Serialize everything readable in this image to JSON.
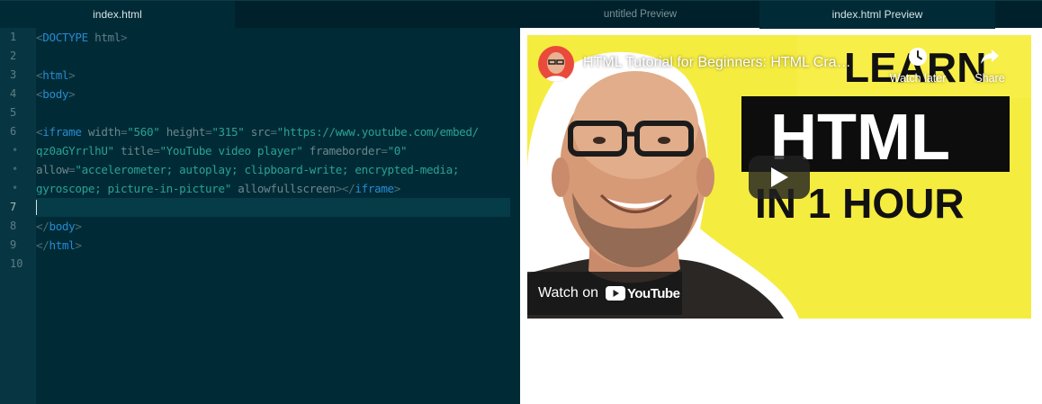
{
  "editor": {
    "tab_label": "index.html",
    "line_numbers": [
      "1",
      "2",
      "3",
      "4",
      "5",
      "6",
      "•",
      "•",
      "•",
      "7",
      "8",
      "9",
      "10"
    ],
    "active_line": "7",
    "code": {
      "doctype": "<DOCTYPE html>",
      "html_open": "<html>",
      "body_open": "<body>",
      "body_close": "</body>",
      "html_close": "</html>",
      "iframe": {
        "tag": "iframe",
        "width_attr": "width",
        "width_val": "\"560\"",
        "height_attr": "height",
        "height_val": "\"315\"",
        "src_attr": "src",
        "src_val_1": "\"https://www.youtube.com/embed/",
        "src_val_2": "qz0aGYrrlhU\"",
        "title_attr": "title",
        "title_val": "\"YouTube video player\"",
        "frameborder_attr": "frameborder",
        "frameborder_val": "\"0\"",
        "allow_attr": "allow",
        "allow_val_1": "\"accelerometer; autoplay; clipboard-write; encrypted-media;",
        "allow_val_2": "gyroscope; picture-in-picture\"",
        "allowfullscreen": "allowfullscreen"
      }
    }
  },
  "preview": {
    "tabs": [
      {
        "label": "untitled Preview",
        "active": false
      },
      {
        "label": "index.html Preview",
        "active": true
      }
    ],
    "video": {
      "title": "HTML Tutorial for Beginners: HTML Cra…",
      "watch_later": "Watch later",
      "share": "Share",
      "thumb_text_1": "LEARN",
      "thumb_text_2": "HTML",
      "thumb_text_3": "IN 1 HOUR",
      "watch_on": "Watch on",
      "youtube": "YouTube"
    }
  },
  "colors": {
    "editor_bg": "#002b36",
    "gutter_bg": "#073642",
    "active_line_bg": "#053c48",
    "tag": "#268bd2",
    "string": "#2aa198",
    "attribute": "#6c868d",
    "thumbnail_yellow": "#f5ec40"
  }
}
